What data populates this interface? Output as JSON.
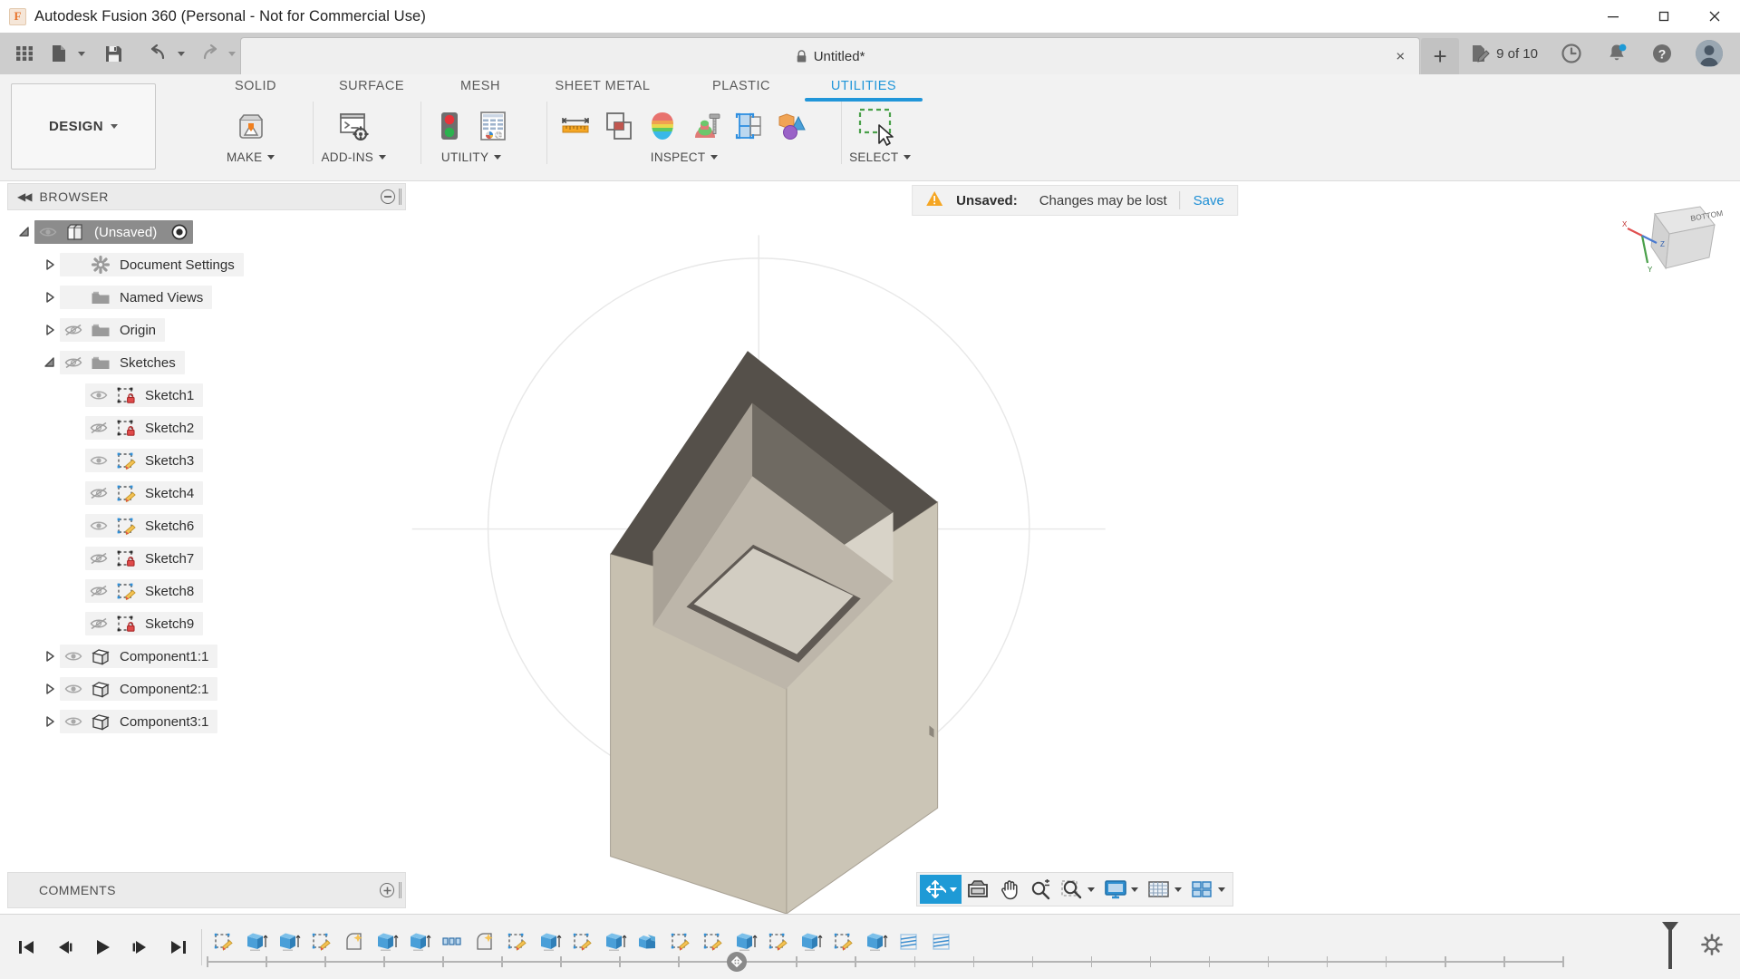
{
  "window": {
    "app_title": "Autodesk Fusion 360 (Personal - Not for Commercial Use)",
    "logo_letter": "F",
    "minimize_icon": "minimize-icon",
    "maximize_icon": "maximize-icon",
    "close_icon": "close-icon"
  },
  "quick_access": {
    "grid_label": "app-grid",
    "new_label": "new-document",
    "save_label": "save",
    "undo_label": "undo",
    "redo_label": "redo"
  },
  "document_tab": {
    "title": "Untitled*",
    "lock_icon": "lock-icon",
    "close_label": "×",
    "add_tab_label": "+"
  },
  "account_bar": {
    "jobs_text": "9 of 10",
    "jobs_icon": "job-status-icon",
    "history_icon": "clock-icon",
    "notifications_icon": "bell-icon",
    "help_icon": "help-icon",
    "avatar_icon": "user-avatar"
  },
  "workspace": {
    "selector_label": "DESIGN"
  },
  "ribbon": {
    "tabs": [
      {
        "label": "SOLID",
        "active": false
      },
      {
        "label": "SURFACE",
        "active": false
      },
      {
        "label": "MESH",
        "active": false
      },
      {
        "label": "SHEET METAL",
        "active": false
      },
      {
        "label": "PLASTIC",
        "active": false
      },
      {
        "label": "UTILITIES",
        "active": true
      }
    ],
    "panels": [
      {
        "title": "MAKE",
        "has_caret": true,
        "icons": [
          "3d-print-icon"
        ]
      },
      {
        "title": "ADD-INS",
        "has_caret": true,
        "icons": [
          "scripts-and-addins-icon"
        ]
      },
      {
        "title": "UTILITY",
        "has_caret": true,
        "icons": [
          "model-state-icon",
          "spreadsheet-icon"
        ]
      },
      {
        "title": "INSPECT",
        "has_caret": true,
        "icons": [
          "measure-icon",
          "interference-icon",
          "section-analysis-icon",
          "curvature-comb-icon",
          "zebra-icon",
          "component-color-cycle-icon"
        ]
      },
      {
        "title": "SELECT",
        "has_caret": true,
        "icons": [
          "window-selection-icon"
        ]
      }
    ]
  },
  "browser": {
    "title": "BROWSER",
    "collapse_icon": "collapse-left-icon",
    "minimize_icon": "minimize-panel-icon",
    "tree": [
      {
        "label": "(Unsaved)",
        "indent": 0,
        "twist": "expanded",
        "eye": "visible",
        "icon": "document-icon",
        "selected": true,
        "trailing_icon": "activate-radio-icon"
      },
      {
        "label": "Document Settings",
        "indent": 1,
        "twist": "collapsed",
        "eye": "none",
        "icon": "gear-icon",
        "selected": false
      },
      {
        "label": "Named Views",
        "indent": 1,
        "twist": "collapsed",
        "eye": "none",
        "icon": "folder-icon",
        "selected": false
      },
      {
        "label": "Origin",
        "indent": 1,
        "twist": "collapsed",
        "eye": "hidden",
        "icon": "folder-icon",
        "selected": false
      },
      {
        "label": "Sketches",
        "indent": 1,
        "twist": "expanded",
        "eye": "hidden",
        "icon": "folder-icon",
        "selected": false
      },
      {
        "label": "Sketch1",
        "indent": 2,
        "twist": "none",
        "eye": "visible",
        "icon": "sketch-locked-icon",
        "selected": false
      },
      {
        "label": "Sketch2",
        "indent": 2,
        "twist": "none",
        "eye": "hidden",
        "icon": "sketch-locked-icon",
        "selected": false
      },
      {
        "label": "Sketch3",
        "indent": 2,
        "twist": "none",
        "eye": "visible",
        "icon": "sketch-editable-icon",
        "selected": false
      },
      {
        "label": "Sketch4",
        "indent": 2,
        "twist": "none",
        "eye": "hidden",
        "icon": "sketch-editable-icon",
        "selected": false
      },
      {
        "label": "Sketch6",
        "indent": 2,
        "twist": "none",
        "eye": "visible",
        "icon": "sketch-editable-icon",
        "selected": false
      },
      {
        "label": "Sketch7",
        "indent": 2,
        "twist": "none",
        "eye": "hidden",
        "icon": "sketch-locked-icon",
        "selected": false
      },
      {
        "label": "Sketch8",
        "indent": 2,
        "twist": "none",
        "eye": "hidden",
        "icon": "sketch-editable-icon",
        "selected": false
      },
      {
        "label": "Sketch9",
        "indent": 2,
        "twist": "none",
        "eye": "hidden",
        "icon": "sketch-locked-icon",
        "selected": false
      },
      {
        "label": "Component1:1",
        "indent": 1,
        "twist": "collapsed",
        "eye": "visible",
        "icon": "component-icon",
        "selected": false
      },
      {
        "label": "Component2:1",
        "indent": 1,
        "twist": "collapsed",
        "eye": "visible",
        "icon": "component-icon",
        "selected": false
      },
      {
        "label": "Component3:1",
        "indent": 1,
        "twist": "collapsed",
        "eye": "visible",
        "icon": "component-icon",
        "selected": false
      }
    ]
  },
  "comments": {
    "title": "COMMENTS",
    "add_icon": "add-comment-icon"
  },
  "notification": {
    "warning_icon": "warning-icon",
    "label": "Unsaved:",
    "message": "Changes may be lost",
    "action": "Save"
  },
  "viewcube": {
    "face_label": "BOTTOM",
    "axis_x": "X",
    "axis_y": "Y",
    "axis_z": "Z"
  },
  "navigation_bar": {
    "items": [
      {
        "name": "orbit-tool",
        "icon": "orbit-icon",
        "caret": true,
        "active": true
      },
      {
        "name": "look-at-tool",
        "icon": "look-at-icon",
        "caret": false,
        "active": false
      },
      {
        "name": "pan-tool",
        "icon": "pan-hand-icon",
        "caret": false,
        "active": false
      },
      {
        "name": "zoom-tool",
        "icon": "zoom-magnifier-icon",
        "caret": false,
        "active": false
      },
      {
        "name": "fit-tool",
        "icon": "zoom-window-icon",
        "caret": true,
        "active": false
      },
      {
        "name": "display-settings",
        "icon": "monitor-icon",
        "caret": true,
        "active": false
      },
      {
        "name": "grid-and-snaps",
        "icon": "grid-icon",
        "caret": true,
        "active": false
      },
      {
        "name": "viewports",
        "icon": "viewports-icon",
        "caret": true,
        "active": false
      }
    ]
  },
  "timeline": {
    "playback": [
      {
        "name": "go-to-beginning",
        "icon": "skip-start-icon"
      },
      {
        "name": "step-back",
        "icon": "step-back-icon"
      },
      {
        "name": "play",
        "icon": "play-icon"
      },
      {
        "name": "step-forward",
        "icon": "step-forward-icon"
      },
      {
        "name": "go-to-end",
        "icon": "skip-end-icon"
      }
    ],
    "nodes": [
      {
        "type": "sketch"
      },
      {
        "type": "extrude"
      },
      {
        "type": "extrude"
      },
      {
        "type": "sketch"
      },
      {
        "type": "fillet"
      },
      {
        "type": "extrude"
      },
      {
        "type": "extrude"
      },
      {
        "type": "pattern"
      },
      {
        "type": "fillet"
      },
      {
        "type": "sketch"
      },
      {
        "type": "extrude"
      },
      {
        "type": "sketch"
      },
      {
        "type": "extrude"
      },
      {
        "type": "combine"
      },
      {
        "type": "sketch"
      },
      {
        "type": "sketch"
      },
      {
        "type": "extrude"
      },
      {
        "type": "sketch"
      },
      {
        "type": "extrude"
      },
      {
        "type": "sketch"
      },
      {
        "type": "extrude"
      },
      {
        "type": "thread"
      },
      {
        "type": "thread"
      }
    ],
    "marker_icon": "timeline-marker-icon",
    "end_marker_icon": "timeline-end-marker-icon",
    "settings_icon": "gear-icon"
  },
  "colors": {
    "accent": "#2196d9",
    "warning": "#f0a020",
    "link": "#1e8fd5",
    "titlebar": "#ffffff",
    "qat": "#cdcdcd",
    "ribbon": "#f2f2f2",
    "model_body": "#c9c2b2",
    "model_rim": "#55504a"
  }
}
